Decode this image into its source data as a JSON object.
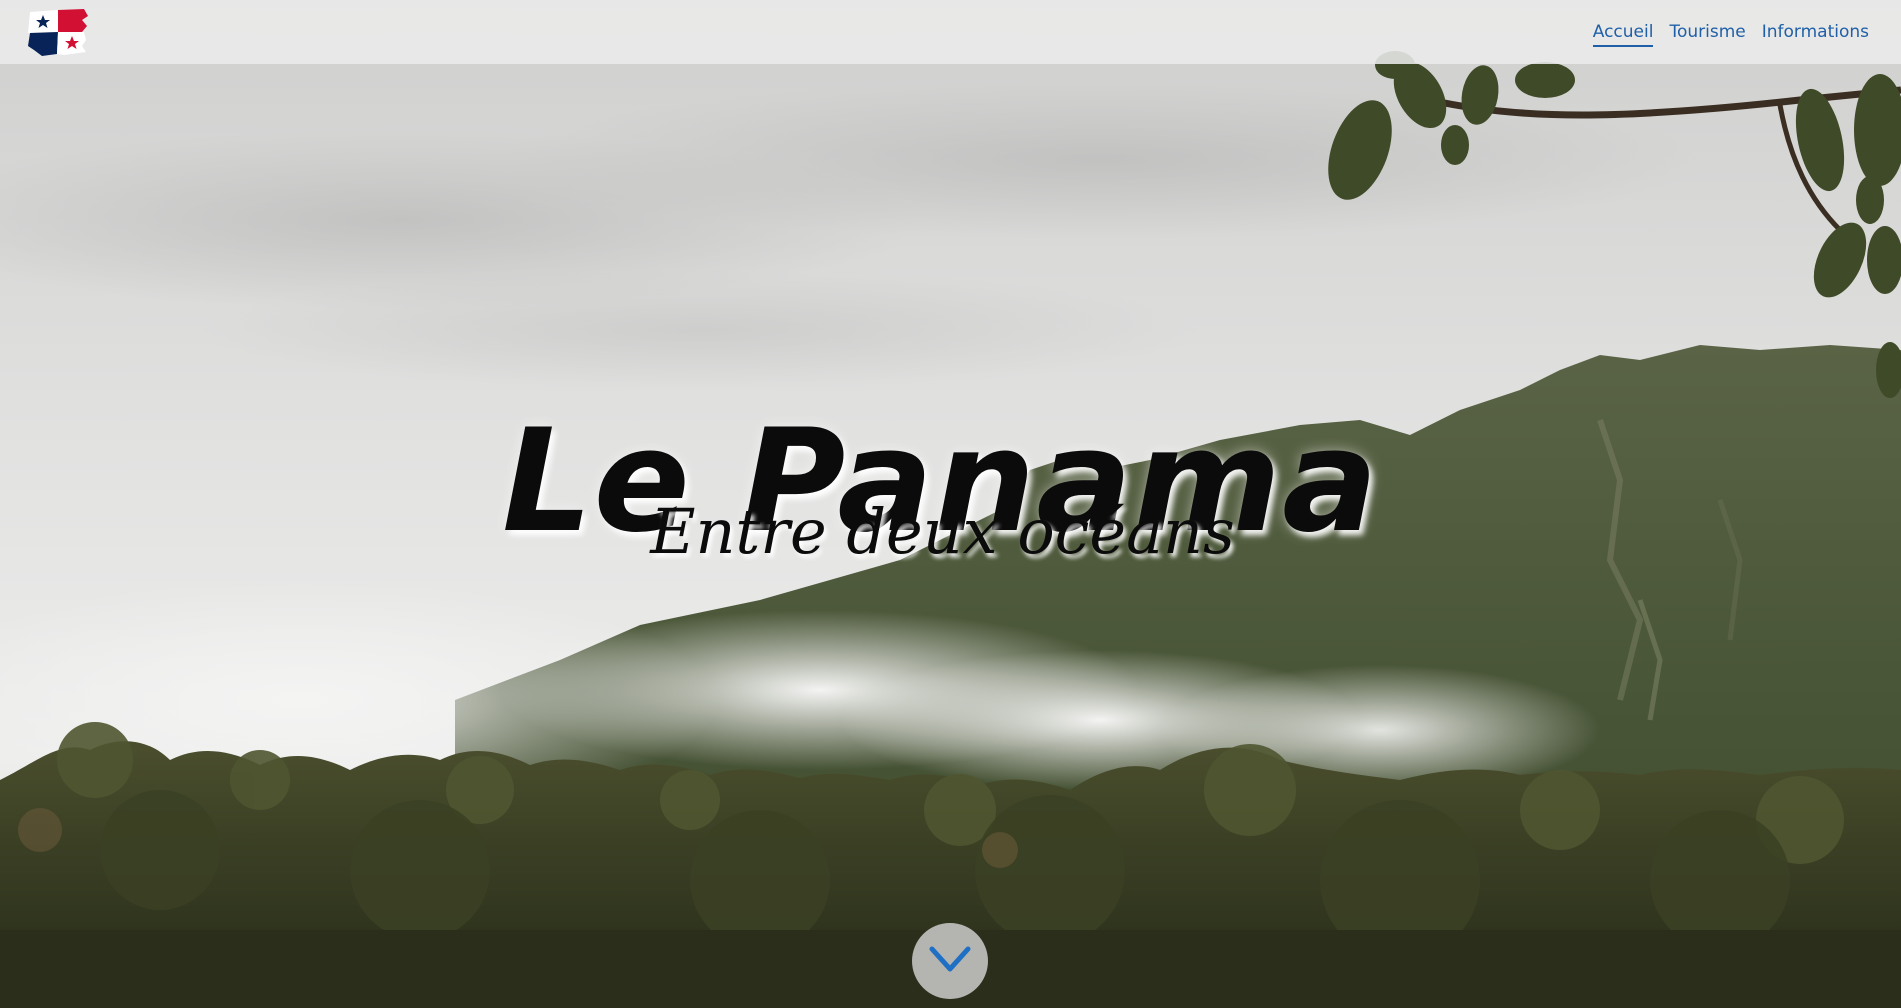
{
  "brand": {
    "logo_icon": "panama-flag-icon",
    "flag_colors": {
      "red": "#d21034",
      "blue": "#072357",
      "white": "#ffffff"
    }
  },
  "nav": {
    "items": [
      {
        "label": "Accueil",
        "active": true
      },
      {
        "label": "Tourisme",
        "active": false
      },
      {
        "label": "Informations",
        "active": false
      }
    ],
    "link_color": "#1f5fa8"
  },
  "hero": {
    "title": "Le Panama",
    "subtitle": "Entre deux océans",
    "background": "misty-rainforest-mountain-photo"
  },
  "scroll_button": {
    "icon": "chevron-down-icon"
  }
}
